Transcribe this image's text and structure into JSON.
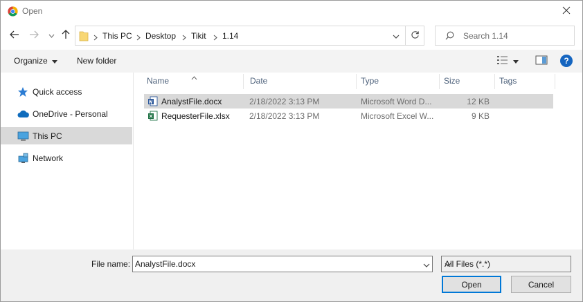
{
  "window": {
    "title": "Open",
    "app_icon": "chrome-icon",
    "accent": "#0078d7"
  },
  "nav": {
    "back_icon": "arrow-left-icon",
    "forward_icon": "arrow-right-icon",
    "recent_icon": "chevron-down-icon",
    "up_icon": "arrow-up-icon"
  },
  "address": {
    "crumbs": [
      "This PC",
      "Desktop",
      "Tikit",
      "1.14"
    ]
  },
  "search": {
    "placeholder": "Search 1.14"
  },
  "commands": {
    "organize": "Organize",
    "new_folder": "New folder",
    "help": "?"
  },
  "sidebar": {
    "items": [
      {
        "label": "Quick access",
        "icon": "star-icon"
      },
      {
        "label": "OneDrive - Personal",
        "icon": "cloud-icon"
      },
      {
        "label": "This PC",
        "icon": "monitor-icon",
        "selected": true
      },
      {
        "label": "Network",
        "icon": "network-icon"
      }
    ]
  },
  "columns": [
    "Name",
    "Date",
    "Type",
    "Size",
    "Tags"
  ],
  "files": [
    {
      "name": "AnalystFile.docx",
      "date": "2/18/2022 3:13 PM",
      "type": "Microsoft Word D...",
      "size": "12 KB",
      "icon": "word-doc-icon",
      "selected": true
    },
    {
      "name": "RequesterFile.xlsx",
      "date": "2/18/2022 3:13 PM",
      "type": "Microsoft Excel W...",
      "size": "9 KB",
      "icon": "excel-sheet-icon",
      "selected": false
    }
  ],
  "footer": {
    "file_name_label": "File name:",
    "file_name_value": "AnalystFile.docx",
    "filter_value": "All Files (*.*)",
    "open_label": "Open",
    "cancel_label": "Cancel"
  }
}
